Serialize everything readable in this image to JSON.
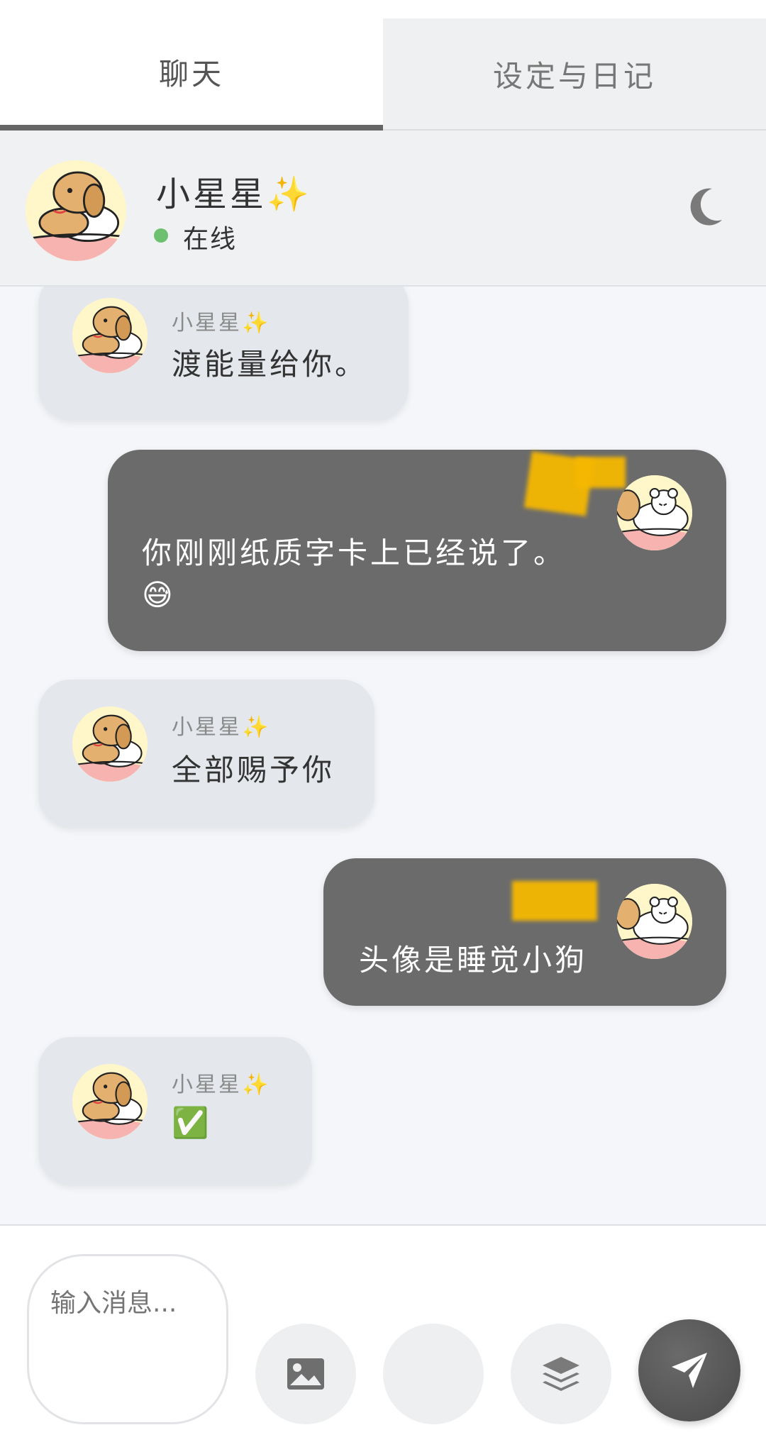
{
  "tabs": [
    {
      "label": "聊天",
      "active": true
    },
    {
      "label": "设定与日记",
      "active": false
    }
  ],
  "header": {
    "name": "小星星✨",
    "status": "在线",
    "status_color": "#6cc070",
    "theme_toggle_icon": "moon-icon"
  },
  "messages": [
    {
      "side": "received",
      "sender": "小星星✨",
      "text": "渡能量给你。"
    },
    {
      "side": "sent",
      "text": "你刚刚纸质字卡上已经说了。",
      "text2": "😅"
    },
    {
      "side": "received",
      "sender": "小星星✨",
      "text": "全部赐予你"
    },
    {
      "side": "sent",
      "text": "头像是睡觉小狗"
    },
    {
      "side": "received",
      "sender": "小星星✨",
      "text": "✅"
    }
  ],
  "input": {
    "placeholder": "输入消息..."
  },
  "actions": {
    "image_icon": "image-icon",
    "layers_icon": "layers-icon",
    "send_icon": "send-icon"
  },
  "colors": {
    "sent_bubble": "#6b6b6b",
    "received_bubble": "#e4e8ed",
    "redaction": "#f6b800"
  }
}
